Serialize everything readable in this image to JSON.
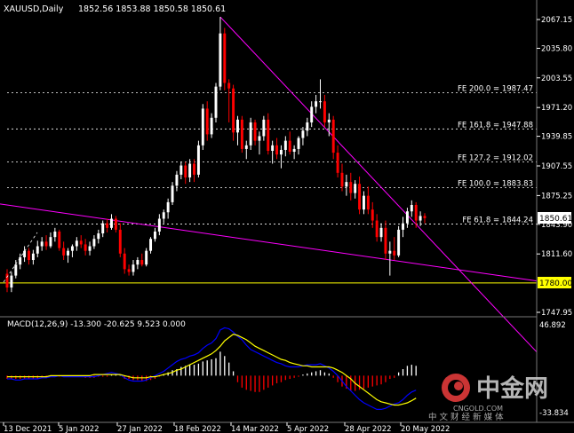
{
  "header": {
    "symbol": "XAUUSD,Daily",
    "ohlc": "1852.56 1853.88 1850.58 1850.61"
  },
  "price_badge": {
    "value": "1850.61",
    "color": "#ffffff"
  },
  "level_badge": {
    "value": "1780.00",
    "color": "#ffff00"
  },
  "watermark": {
    "brand": "中金网",
    "site": "CNGOLD.COM",
    "tagline": "中 文 财 经 新 媒 体"
  },
  "colors": {
    "background": "#000000",
    "bull_candle": "#ffffff",
    "bear_candle": "#ff0000",
    "trendline": "#ff00ff",
    "support_line": "#ffff00",
    "fib_lines": "#ffffff",
    "macd_histogram_up": "#ffffff",
    "macd_histogram_down": "#ff0000",
    "macd_line": "#0000ff",
    "signal_line": "#ffff00"
  },
  "chart_data": [
    {
      "type": "candlestick",
      "title": "XAUUSD,Daily",
      "yaxis_ticks": [
        "2067.15",
        "2035.80",
        "2003.55",
        "1971.20",
        "1939.85",
        "1907.55",
        "1875.25",
        "1843.90",
        "1811.60",
        "1747.95"
      ],
      "ylim": [
        1735,
        2080
      ],
      "xaxis_ticks": [
        "13 Dec 2021",
        "5 Jan 2022",
        "27 Jan 2022",
        "18 Feb 2022",
        "14 Mar 2022",
        "5 Apr 2022",
        "28 Apr 2022",
        "20 May 2022"
      ],
      "candles": [
        [
          1790,
          1795,
          1770,
          1775
        ],
        [
          1775,
          1792,
          1770,
          1788
        ],
        [
          1788,
          1805,
          1785,
          1800
        ],
        [
          1800,
          1812,
          1795,
          1808
        ],
        [
          1808,
          1820,
          1803,
          1815
        ],
        [
          1815,
          1818,
          1800,
          1805
        ],
        [
          1805,
          1816,
          1800,
          1812
        ],
        [
          1812,
          1826,
          1808,
          1820
        ],
        [
          1820,
          1830,
          1815,
          1825
        ],
        [
          1825,
          1832,
          1816,
          1820
        ],
        [
          1820,
          1835,
          1818,
          1830
        ],
        [
          1830,
          1840,
          1825,
          1836
        ],
        [
          1836,
          1838,
          1815,
          1818
        ],
        [
          1818,
          1825,
          1805,
          1810
        ],
        [
          1810,
          1818,
          1802,
          1815
        ],
        [
          1815,
          1822,
          1808,
          1820
        ],
        [
          1820,
          1830,
          1815,
          1826
        ],
        [
          1826,
          1832,
          1818,
          1822
        ],
        [
          1822,
          1828,
          1810,
          1815
        ],
        [
          1815,
          1825,
          1810,
          1820
        ],
        [
          1820,
          1832,
          1817,
          1828
        ],
        [
          1828,
          1838,
          1823,
          1834
        ],
        [
          1834,
          1848,
          1830,
          1845
        ],
        [
          1845,
          1850,
          1835,
          1840
        ],
        [
          1840,
          1855,
          1838,
          1850
        ],
        [
          1850,
          1853,
          1835,
          1838
        ],
        [
          1838,
          1845,
          1808,
          1812
        ],
        [
          1812,
          1818,
          1790,
          1795
        ],
        [
          1795,
          1800,
          1788,
          1792
        ],
        [
          1792,
          1805,
          1788,
          1800
        ],
        [
          1800,
          1808,
          1795,
          1805
        ],
        [
          1805,
          1812,
          1798,
          1800
        ],
        [
          1800,
          1818,
          1798,
          1815
        ],
        [
          1815,
          1830,
          1812,
          1828
        ],
        [
          1828,
          1840,
          1825,
          1836
        ],
        [
          1836,
          1855,
          1832,
          1850
        ],
        [
          1850,
          1860,
          1845,
          1857
        ],
        [
          1857,
          1872,
          1850,
          1868
        ],
        [
          1868,
          1890,
          1865,
          1886
        ],
        [
          1886,
          1902,
          1880,
          1898
        ],
        [
          1898,
          1912,
          1893,
          1908
        ],
        [
          1908,
          1912,
          1888,
          1895
        ],
        [
          1895,
          1915,
          1890,
          1910
        ],
        [
          1910,
          1915,
          1890,
          1898
        ],
        [
          1898,
          1935,
          1895,
          1930
        ],
        [
          1930,
          1975,
          1925,
          1970
        ],
        [
          1970,
          1978,
          1935,
          1942
        ],
        [
          1942,
          1965,
          1938,
          1960
        ],
        [
          1960,
          1998,
          1955,
          1994
        ],
        [
          1994,
          2070,
          1990,
          2052
        ],
        [
          2052,
          2058,
          1990,
          1998
        ],
        [
          1998,
          2002,
          1955,
          1992
        ],
        [
          1992,
          1996,
          1935,
          1944
        ],
        [
          1944,
          1962,
          1930,
          1958
        ],
        [
          1958,
          1962,
          1922,
          1926
        ],
        [
          1926,
          1935,
          1915,
          1930
        ],
        [
          1930,
          1960,
          1925,
          1955
        ],
        [
          1955,
          1958,
          1930,
          1935
        ],
        [
          1935,
          1945,
          1920,
          1940
        ],
        [
          1940,
          1962,
          1935,
          1958
        ],
        [
          1958,
          1965,
          1920,
          1924
        ],
        [
          1924,
          1935,
          1910,
          1930
        ],
        [
          1930,
          1938,
          1915,
          1920
        ],
        [
          1920,
          1930,
          1905,
          1925
        ],
        [
          1925,
          1940,
          1918,
          1935
        ],
        [
          1935,
          1945,
          1920,
          1923
        ],
        [
          1923,
          1930,
          1915,
          1926
        ],
        [
          1926,
          1940,
          1920,
          1938
        ],
        [
          1938,
          1950,
          1930,
          1946
        ],
        [
          1946,
          1960,
          1940,
          1955
        ],
        [
          1955,
          1978,
          1950,
          1972
        ],
        [
          1972,
          1985,
          1965,
          1978
        ],
        [
          1978,
          2002,
          1970,
          1978
        ],
        [
          1978,
          1985,
          1950,
          1955
        ],
        [
          1955,
          1965,
          1940,
          1958
        ],
        [
          1958,
          1962,
          1915,
          1922
        ],
        [
          1922,
          1930,
          1895,
          1900
        ],
        [
          1900,
          1910,
          1880,
          1885
        ],
        [
          1885,
          1898,
          1875,
          1890
        ],
        [
          1890,
          1900,
          1870,
          1878
        ],
        [
          1878,
          1892,
          1872,
          1888
        ],
        [
          1888,
          1896,
          1855,
          1860
        ],
        [
          1860,
          1880,
          1855,
          1875
        ],
        [
          1875,
          1885,
          1855,
          1860
        ],
        [
          1860,
          1868,
          1840,
          1848
        ],
        [
          1848,
          1855,
          1825,
          1830
        ],
        [
          1830,
          1845,
          1825,
          1840
        ],
        [
          1840,
          1848,
          1805,
          1812
        ],
        [
          1812,
          1825,
          1788,
          1815
        ],
        [
          1815,
          1830,
          1805,
          1810
        ],
        [
          1810,
          1842,
          1808,
          1838
        ],
        [
          1838,
          1852,
          1830,
          1845
        ],
        [
          1845,
          1862,
          1840,
          1858
        ],
        [
          1858,
          1870,
          1852,
          1865
        ],
        [
          1865,
          1868,
          1840,
          1848
        ],
        [
          1848,
          1858,
          1842,
          1853
        ],
        [
          1853,
          1856,
          1845,
          1850.61
        ]
      ],
      "trendlines": [
        {
          "name": "resistance",
          "from": {
            "bar": 49,
            "price": 2070
          },
          "to": {
            "bar": 94,
            "price": 1844
          }
        },
        {
          "name": "support",
          "from": {
            "bar": 0,
            "price": 1865
          },
          "to": {
            "bar": 94,
            "price": 1801
          }
        }
      ],
      "horizontal_levels": [
        {
          "label": "FE 200.0 = 1987.47",
          "price": 1987.47
        },
        {
          "label": "FE 161.8 = 1947.88",
          "price": 1947.88
        },
        {
          "label": "FE 127.2 = 1912.02",
          "price": 1912.02
        },
        {
          "label": "FE 100.0 = 1883.83",
          "price": 1883.83
        },
        {
          "label": "FE 61.8 = 1844.24",
          "price": 1844.24
        },
        {
          "label": "",
          "price": 1780.0,
          "color": "#ffff00"
        }
      ]
    },
    {
      "type": "macd",
      "title": "MACD(12,26,9) -13.300 -20.625 9.523 0.000",
      "yaxis_ticks": [
        "46.892",
        "-33.834"
      ],
      "ylim": [
        -38,
        50
      ],
      "histogram": [
        -3,
        -3,
        -3,
        -3,
        -3,
        -3,
        -3,
        -3,
        -2,
        -2,
        -1,
        -1,
        -1,
        -1,
        -1,
        -1,
        -1,
        -1,
        -2,
        -2,
        -2,
        -1,
        -1,
        -1,
        1,
        1,
        1,
        -3,
        -3,
        -4,
        -4,
        -5,
        -5,
        -4,
        -3,
        -1,
        1,
        3,
        5,
        6,
        8,
        9,
        10,
        10,
        11,
        13,
        14,
        15,
        16,
        22,
        18,
        12,
        4,
        -6,
        -11,
        -13,
        -14,
        -15,
        -15,
        -13,
        -11,
        -9,
        -7,
        -6,
        -4,
        -3,
        -2,
        -1,
        1,
        2,
        3,
        4,
        5,
        3,
        2,
        -2,
        -6,
        -10,
        -12,
        -14,
        -14,
        -13,
        -12,
        -11,
        -10,
        -9,
        -8,
        -6,
        -3,
        -2,
        3,
        6,
        9,
        10,
        9
      ],
      "macd_line": [
        -3,
        -3,
        -4,
        -4,
        -3,
        -3,
        -3,
        -3,
        -2,
        -2,
        -1,
        -1,
        0,
        -1,
        -1,
        -1,
        -1,
        -1,
        -1,
        -1,
        -1,
        0,
        1,
        2,
        3,
        2,
        1,
        -2,
        -4,
        -5,
        -5,
        -5,
        -4,
        -2,
        0,
        2,
        4,
        7,
        10,
        13,
        15,
        16,
        18,
        19,
        21,
        25,
        28,
        30,
        34,
        42,
        44,
        43,
        40,
        36,
        33,
        28,
        24,
        22,
        20,
        18,
        16,
        14,
        12,
        11,
        9,
        8,
        8,
        8,
        9,
        10,
        10,
        10,
        11,
        9,
        7,
        4,
        0,
        -5,
        -10,
        -14,
        -18,
        -22,
        -25,
        -27,
        -29,
        -31,
        -31,
        -30,
        -28,
        -26,
        -25,
        -22,
        -18,
        -15,
        -13.3
      ],
      "signal_line": [
        -1,
        -1,
        -1,
        -1,
        -1,
        -1,
        -1,
        -1,
        -1,
        -1,
        0,
        0,
        0,
        0,
        0,
        0,
        0,
        0,
        0,
        0,
        1,
        1,
        1,
        1,
        1,
        1,
        1,
        0,
        -1,
        -2,
        -2,
        -2,
        -2,
        -1,
        -1,
        0,
        1,
        2,
        3,
        5,
        6,
        8,
        10,
        12,
        14,
        16,
        18,
        20,
        23,
        27,
        32,
        35,
        38,
        37,
        35,
        33,
        30,
        27,
        25,
        23,
        21,
        19,
        17,
        15,
        14,
        12,
        11,
        10,
        9,
        9,
        8,
        8,
        8,
        8,
        8,
        7,
        5,
        3,
        0,
        -3,
        -7,
        -10,
        -13,
        -16,
        -19,
        -22,
        -24,
        -25,
        -26,
        -27,
        -27,
        -26,
        -25,
        -23,
        -20.625
      ]
    }
  ]
}
